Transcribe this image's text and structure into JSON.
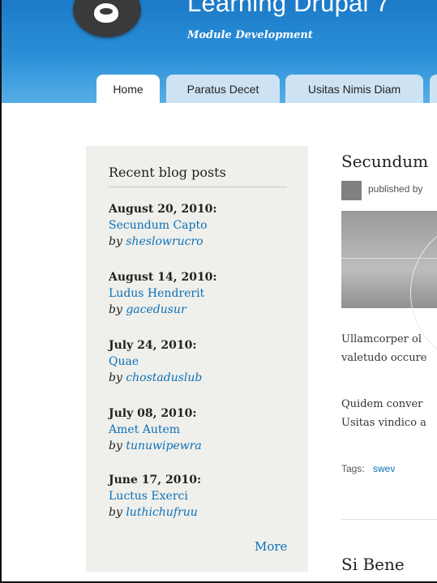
{
  "header": {
    "site_name": "Learning Drupal 7",
    "slogan": "Module Development",
    "logo_icon": "drupal-drop-icon"
  },
  "tabs": [
    {
      "label": "Home",
      "active": true
    },
    {
      "label": "Paratus Decet",
      "active": false
    },
    {
      "label": "Usitas Nimis Diam",
      "active": false
    },
    {
      "label": "",
      "active": false
    }
  ],
  "sidebar": {
    "block_title": "Recent blog posts",
    "posts": [
      {
        "date": "August 20, 2010:",
        "title": "Secundum Capto",
        "by": "by",
        "author": "sheslowrucro"
      },
      {
        "date": "August 14, 2010:",
        "title": "Ludus Hendrerit",
        "by": "by",
        "author": "gacedusur"
      },
      {
        "date": "July 24, 2010:",
        "title": "Quae",
        "by": "by",
        "author": "chostaduslub"
      },
      {
        "date": "July 08, 2010:",
        "title": "Amet Autem",
        "by": "by",
        "author": "tunuwipewra"
      },
      {
        "date": "June 17, 2010:",
        "title": "Luctus Exerci",
        "by": "by",
        "author": "luthichufruu"
      }
    ],
    "more_label": "More"
  },
  "main": {
    "node_title": "Secundum",
    "byline": "published by",
    "paragraphs": [
      [
        "Ullamcorper ol",
        "valetudo occure"
      ],
      [
        "Quidem conver",
        "Usitas vindico a"
      ]
    ],
    "tags_label": "Tags:",
    "tags": [
      "swev"
    ],
    "next_node_title": "Si Bene"
  },
  "colors": {
    "header_blue": "#2b90d8",
    "tab_inactive": "#cde3f4",
    "link": "#0c71b8",
    "sidebar_bg": "#efefeb"
  }
}
